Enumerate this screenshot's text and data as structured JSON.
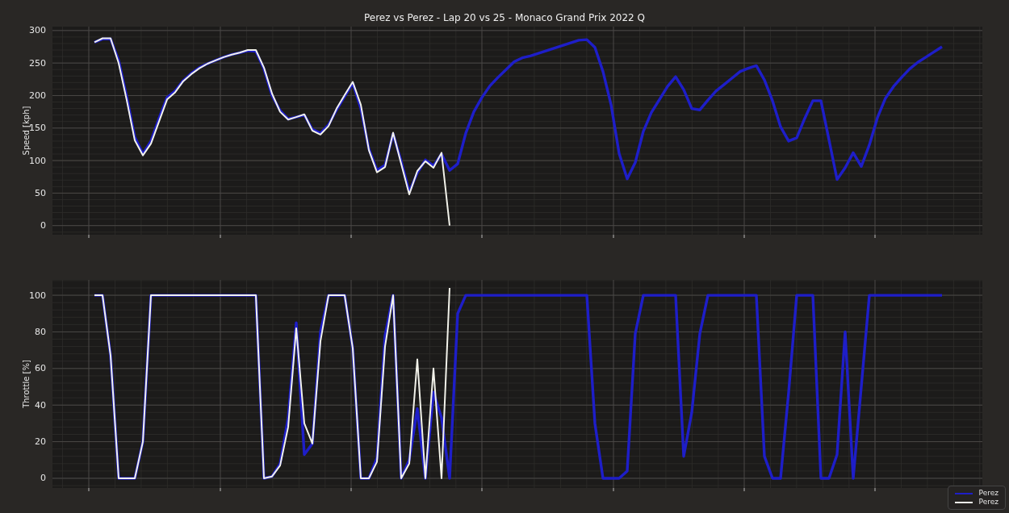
{
  "figure": {
    "title": "Perez vs Perez - Lap 20 vs 25 - Monaco Grand Prix 2022 Q"
  },
  "speed_chart": {
    "chart_data": {
      "type": "line",
      "grid": true,
      "ylabel": "Speed [kph]",
      "ylim": [
        -14,
        306
      ],
      "yticks": [
        0,
        50,
        100,
        150,
        200,
        250,
        300
      ],
      "categories": [
        null,
        null,
        null,
        null,
        null,
        null,
        null,
        null,
        null,
        null,
        null,
        null,
        null,
        null,
        null,
        null,
        null,
        null,
        null,
        null,
        null,
        null,
        null,
        null,
        null,
        null,
        null,
        null,
        null,
        null,
        null,
        null,
        null,
        null,
        null,
        null,
        null,
        null,
        null,
        null,
        null,
        null,
        null,
        null,
        null,
        null,
        null,
        null,
        null,
        null,
        null,
        null,
        null,
        null,
        null,
        null,
        null,
        null,
        null,
        null,
        null,
        null,
        null,
        null,
        null,
        null,
        null,
        null,
        null,
        null,
        null,
        null,
        null,
        null,
        null,
        null,
        null,
        null,
        null,
        null,
        null,
        null,
        null,
        null,
        null,
        null,
        null,
        null,
        null,
        null,
        null,
        null,
        null,
        null,
        null,
        null,
        null,
        null,
        null,
        null,
        null,
        null,
        null,
        null,
        null,
        null
      ],
      "series": [
        {
          "name": "Perez",
          "color": "#1e1ec8",
          "values": [
            282,
            287,
            287,
            254,
            198,
            136,
            110,
            130,
            165,
            197,
            207,
            223,
            234,
            243,
            249,
            254,
            259,
            263,
            266,
            269,
            268,
            241,
            200,
            177,
            164,
            167,
            170,
            148,
            142,
            155,
            178,
            199,
            219,
            180,
            118,
            85,
            93,
            141,
            99,
            52,
            81,
            101,
            92,
            110,
            85,
            95,
            142,
            175,
            197,
            215,
            228,
            240,
            252,
            258,
            261,
            265,
            269,
            273,
            277,
            281,
            285,
            286,
            274,
            237,
            186,
            111,
            72,
            97,
            145,
            174,
            194,
            214,
            229,
            209,
            180,
            178,
            193,
            207,
            217,
            227,
            237,
            242,
            246,
            224,
            192,
            152,
            130,
            135,
            165,
            192,
            192,
            132,
            71,
            89,
            112,
            91,
            124,
            166,
            196,
            214,
            228,
            241,
            251,
            259,
            267,
            275
          ]
        },
        {
          "name": "Perez",
          "color": "#f2f2ea",
          "values": [
            282,
            288,
            288,
            250,
            193,
            131,
            108,
            126,
            160,
            194,
            205,
            222,
            233,
            242,
            249,
            254,
            259,
            263,
            266,
            270,
            270,
            243,
            203,
            175,
            163,
            167,
            171,
            146,
            140,
            153,
            180,
            201,
            221,
            186,
            116,
            82,
            90,
            143,
            95,
            48,
            84,
            99,
            89,
            112,
            0,
            null,
            null,
            null,
            null,
            null,
            null,
            null,
            null,
            null,
            null,
            null,
            null,
            null,
            null,
            null,
            null,
            null,
            null,
            null,
            null,
            null,
            null,
            null,
            null,
            null,
            null,
            null,
            null,
            null,
            null,
            null,
            null,
            null,
            null,
            null,
            null,
            null,
            null,
            null,
            null,
            null,
            null,
            null,
            null,
            null,
            null,
            null,
            null,
            null,
            null,
            null,
            null,
            null,
            null,
            null,
            null,
            null,
            null,
            null,
            null,
            null
          ]
        }
      ]
    }
  },
  "throttle_chart": {
    "chart_data": {
      "type": "line",
      "grid": true,
      "ylabel": "Throttle [%]",
      "ylim": [
        -5.3,
        108.4
      ],
      "yticks": [
        0,
        20,
        40,
        60,
        80,
        100
      ],
      "categories": [
        null,
        null,
        null,
        null,
        null,
        null,
        null,
        null,
        null,
        null,
        null,
        null,
        null,
        null,
        null,
        null,
        null,
        null,
        null,
        null,
        null,
        null,
        null,
        null,
        null,
        null,
        null,
        null,
        null,
        null,
        null,
        null,
        null,
        null,
        null,
        null,
        null,
        null,
        null,
        null,
        null,
        null,
        null,
        null,
        null,
        null,
        null,
        null,
        null,
        null,
        null,
        null,
        null,
        null,
        null,
        null,
        null,
        null,
        null,
        null,
        null,
        null,
        null,
        null,
        null,
        null,
        null,
        null,
        null,
        null,
        null,
        null,
        null,
        null,
        null,
        null,
        null,
        null,
        null,
        null,
        null,
        null,
        null,
        null,
        null,
        null,
        null,
        null,
        null,
        null,
        null,
        null,
        null,
        null,
        null,
        null,
        null,
        null,
        null,
        null,
        null,
        null,
        null,
        null,
        null,
        null
      ],
      "series": [
        {
          "color": "#1e1ec8",
          "values": [
            100,
            100,
            67,
            0,
            0,
            0,
            20,
            100,
            100,
            100,
            100,
            100,
            100,
            100,
            100,
            100,
            100,
            100,
            100,
            100,
            100,
            0,
            1,
            8,
            33,
            85,
            13,
            19,
            80,
            100,
            100,
            100,
            71,
            0,
            0,
            11,
            78,
            100,
            0,
            10,
            38,
            0,
            47,
            33,
            0,
            90,
            100,
            100,
            100,
            100,
            100,
            100,
            100,
            100,
            100,
            100,
            100,
            100,
            100,
            100,
            100,
            100,
            30,
            0,
            0,
            0,
            4,
            79,
            100,
            100,
            100,
            100,
            100,
            12,
            36,
            79,
            100,
            100,
            100,
            100,
            100,
            100,
            100,
            12,
            0,
            0,
            47,
            100,
            100,
            100,
            0,
            0,
            13,
            80,
            0,
            50,
            100,
            100,
            100,
            100,
            100,
            100,
            100,
            100,
            100,
            100
          ]
        },
        {
          "color": "#f2f2ea",
          "values": [
            100,
            100,
            67,
            0,
            0,
            0,
            20,
            100,
            100,
            100,
            100,
            100,
            100,
            100,
            100,
            100,
            100,
            100,
            100,
            100,
            100,
            0,
            1,
            7,
            28,
            82,
            30,
            19,
            75,
            100,
            100,
            100,
            71,
            0,
            0,
            9,
            72,
            100,
            0,
            8,
            65,
            0,
            60,
            0,
            104,
            null,
            null,
            null,
            null,
            null,
            null,
            null,
            null,
            null,
            null,
            null,
            null,
            null,
            null,
            null,
            null,
            null,
            null,
            null,
            null,
            null,
            null,
            null,
            null,
            null,
            null,
            null,
            null,
            null,
            null,
            null,
            null,
            null,
            null,
            null,
            null,
            null,
            null,
            null,
            null,
            null,
            null,
            null,
            null,
            null,
            null,
            null,
            null,
            null,
            null,
            null,
            null,
            null,
            null,
            null,
            null,
            null,
            null,
            null,
            null,
            null
          ]
        }
      ]
    }
  }
}
